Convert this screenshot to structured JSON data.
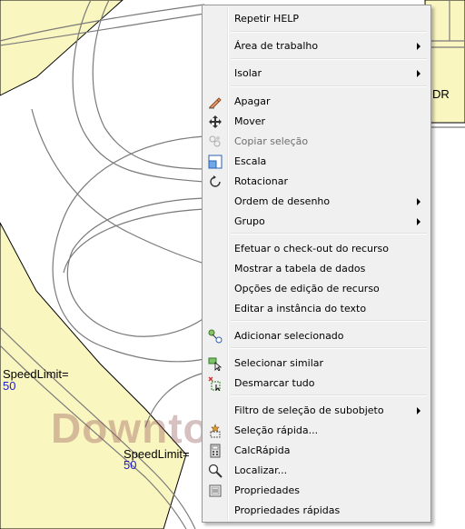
{
  "map": {
    "labels": [
      {
        "text": "SpeedLimit="
      },
      {
        "text": "SpeedLimit="
      }
    ],
    "numbers": [
      "50",
      "50"
    ],
    "watermark_text": "Downtow",
    "dr_label": "DR"
  },
  "menu": {
    "items": [
      {
        "label": "Repetir HELP",
        "submenu": false,
        "disabled": false,
        "icon": null
      },
      {
        "label": "Área de trabalho",
        "submenu": true,
        "disabled": false,
        "icon": null
      },
      {
        "label": "Isolar",
        "submenu": true,
        "disabled": false,
        "icon": null
      },
      {
        "label": "Apagar",
        "submenu": false,
        "disabled": false,
        "icon": "eraser-icon"
      },
      {
        "label": "Mover",
        "submenu": false,
        "disabled": false,
        "icon": "move-icon"
      },
      {
        "label": "Copiar seleção",
        "submenu": false,
        "disabled": true,
        "icon": "copy-selection-icon"
      },
      {
        "label": "Escala",
        "submenu": false,
        "disabled": false,
        "icon": "scale-icon"
      },
      {
        "label": "Rotacionar",
        "submenu": false,
        "disabled": false,
        "icon": "rotate-icon"
      },
      {
        "label": "Ordem de desenho",
        "submenu": true,
        "disabled": false,
        "icon": null
      },
      {
        "label": "Grupo",
        "submenu": true,
        "disabled": false,
        "icon": null
      },
      {
        "label": "Efetuar o check-out do recurso",
        "submenu": false,
        "disabled": false,
        "icon": null
      },
      {
        "label": "Mostrar a tabela de dados",
        "submenu": false,
        "disabled": false,
        "icon": null
      },
      {
        "label": "Opções de edição de recurso",
        "submenu": false,
        "disabled": false,
        "icon": null
      },
      {
        "label": "Editar a instância do texto",
        "submenu": false,
        "disabled": false,
        "icon": null
      },
      {
        "label": "Adicionar selecionado",
        "submenu": false,
        "disabled": false,
        "icon": "add-selected-icon"
      },
      {
        "label": "Selecionar similar",
        "submenu": false,
        "disabled": false,
        "icon": "select-similar-icon"
      },
      {
        "label": "Desmarcar tudo",
        "submenu": false,
        "disabled": false,
        "icon": "deselect-all-icon"
      },
      {
        "label": "Filtro de seleção de subobjeto",
        "submenu": true,
        "disabled": false,
        "icon": null
      },
      {
        "label": "Seleção rápida...",
        "submenu": false,
        "disabled": false,
        "icon": "quick-select-icon"
      },
      {
        "label": "CalcRápida",
        "submenu": false,
        "disabled": false,
        "icon": "calculator-icon"
      },
      {
        "label": "Localizar...",
        "submenu": false,
        "disabled": false,
        "icon": "find-icon"
      },
      {
        "label": "Propriedades",
        "submenu": false,
        "disabled": false,
        "icon": "properties-icon"
      },
      {
        "label": "Propriedades rápidas",
        "submenu": false,
        "disabled": false,
        "icon": null
      }
    ]
  },
  "colors": {
    "map_fill": "#faf6c0",
    "menu_bg": "#f0f0f0",
    "road_stroke": "#7a7a7a",
    "speed_number": "#2020c8"
  }
}
